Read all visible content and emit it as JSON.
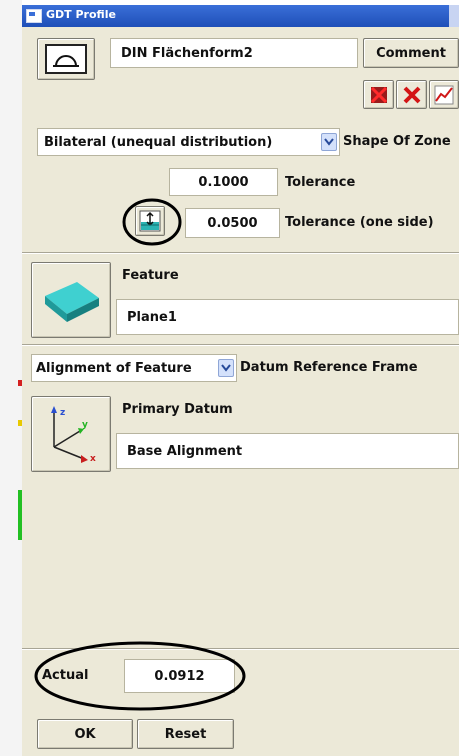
{
  "window": {
    "title": "GDT Profile"
  },
  "header": {
    "name_value": "DIN Flächenform2",
    "comment_label": "Comment"
  },
  "toolbar": {
    "icons": [
      "delete-red-icon",
      "delete-x-icon",
      "graph-icon"
    ]
  },
  "zone": {
    "shape_value": "Bilateral (unequal distribution)",
    "shape_label": "Shape Of Zone"
  },
  "tolerance": {
    "value": "0.1000",
    "label": "Tolerance",
    "one_side_value": "0.0500",
    "one_side_label": "Tolerance (one side)"
  },
  "feature": {
    "label": "Feature",
    "value": "Plane1"
  },
  "alignment": {
    "select_value": "Alignment of Feature",
    "drf_label": "Datum Reference Frame"
  },
  "datum": {
    "label": "Primary Datum",
    "value": "Base Alignment",
    "axes": [
      "z",
      "y",
      "x"
    ]
  },
  "actual": {
    "label": "Actual",
    "value": "0.0912"
  },
  "footer": {
    "ok_label": "OK",
    "reset_label": "Reset"
  },
  "colors": {
    "title_bar": "#2a5cc8",
    "panel": "#ece9d8",
    "plane_icon": "#2bb3b3",
    "annotation_circle": "#000000"
  }
}
